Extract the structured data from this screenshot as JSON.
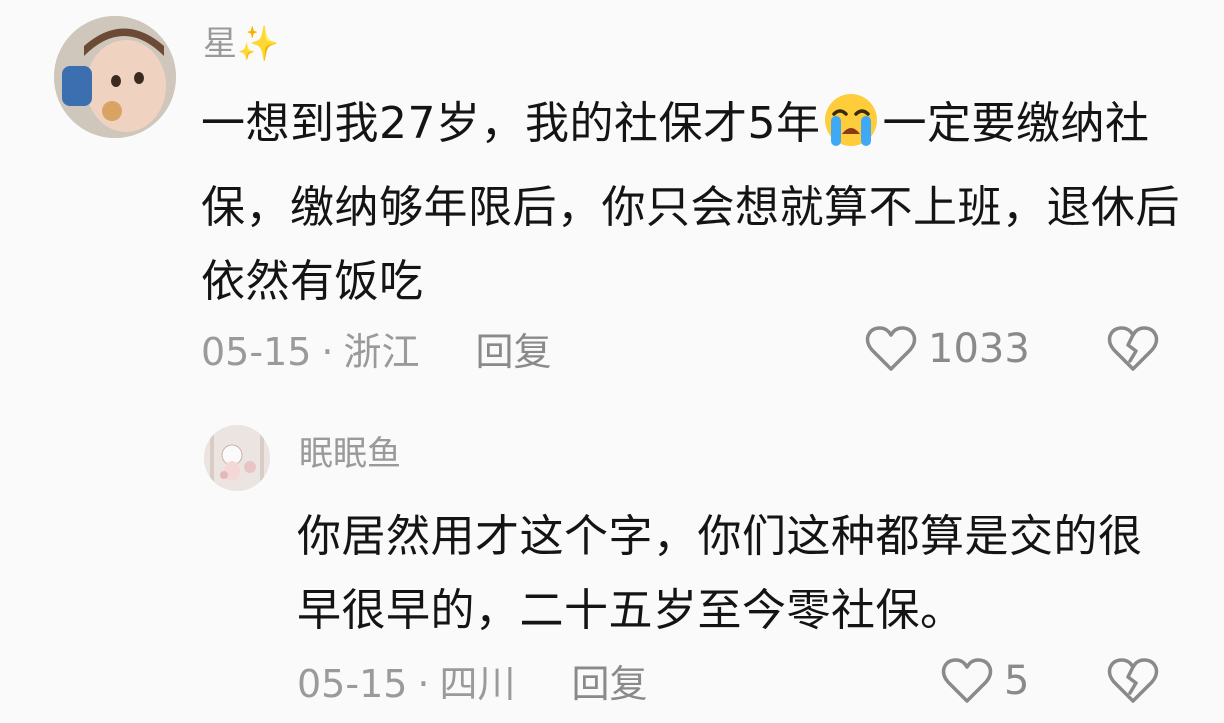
{
  "comment": {
    "username": "星✨",
    "text_part1": "一想到我27岁，我的社保才5年",
    "emoji": "crying-face",
    "text_part2": "一定要缴纳社保，缴纳够年限后，你只会想就算不上班，退休后依然有饭吃",
    "date": "05-15",
    "location": "浙江",
    "reply_label": "回复",
    "likes": "1033"
  },
  "reply": {
    "username": "眠眠鱼",
    "text": "你居然用才这个字，你们这种都算是交的很早很早的，二十五岁至今零社保。",
    "date": "05-15",
    "location": "四川",
    "reply_label": "回复",
    "likes": "5"
  },
  "colors": {
    "meta_gray": "#9a9a9a",
    "text": "#141414",
    "background": "#fafafa"
  }
}
